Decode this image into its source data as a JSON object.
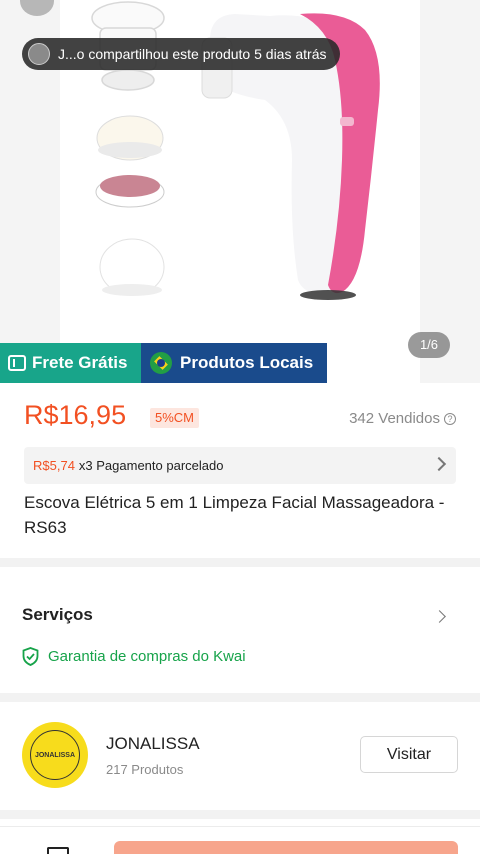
{
  "product_image": {
    "share_text": "J...o compartilhou este produto 5 dias atrás",
    "counter": "1/6"
  },
  "badges": {
    "frete": "Frete Grátis",
    "local": "Produtos Locais"
  },
  "price": {
    "value": "R$16,95",
    "discount": "5%CM",
    "sold": "342 Vendidos"
  },
  "installment": {
    "amount": "R$5,74",
    "text": "x3 Pagamento parcelado"
  },
  "product": {
    "title": "Escova Elétrica 5 em 1 Limpeza Facial Massageadora - RS63"
  },
  "services": {
    "title": "Serviços",
    "guarantee": "Garantia de compras do Kwai"
  },
  "shop": {
    "logo_text": "JONALISSA",
    "name": "JONALISSA",
    "products": "217 Produtos",
    "visit_label": "Visitar"
  },
  "colors": {
    "price": "#f25022",
    "frete_badge": "#18a58a",
    "local_badge": "#1a4b8c",
    "guarantee": "#17a34a",
    "buy_button": "#f7a58c"
  }
}
